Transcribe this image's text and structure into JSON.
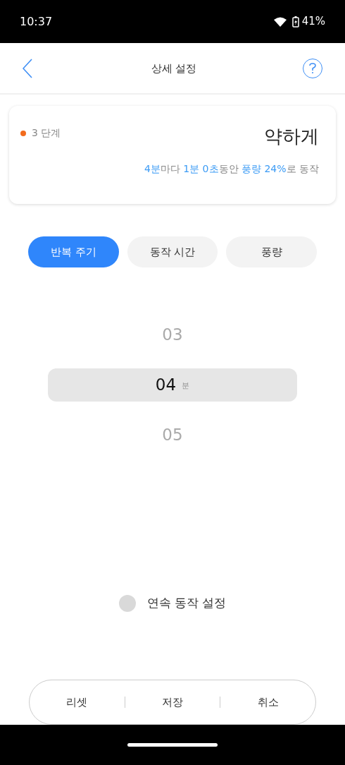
{
  "status_bar": {
    "time": "10:37",
    "battery": "41%"
  },
  "header": {
    "title": "상세 설정"
  },
  "summary": {
    "level": "3 단계",
    "color": "#f26b1d",
    "mode": "약하게",
    "segments": [
      {
        "text": "4분",
        "highlight": true
      },
      {
        "text": "마다 ",
        "highlight": false
      },
      {
        "text": "1분 0초",
        "highlight": true
      },
      {
        "text": "동안 ",
        "highlight": false
      },
      {
        "text": "풍량 24%",
        "highlight": true
      },
      {
        "text": "로 동작",
        "highlight": false
      }
    ]
  },
  "tabs": [
    {
      "label": "반복 주기",
      "selected": true
    },
    {
      "label": "동작 시간",
      "selected": false
    },
    {
      "label": "풍량",
      "selected": false
    }
  ],
  "picker": {
    "unit": "분",
    "items": [
      {
        "value": "03",
        "selected": false
      },
      {
        "value": "04",
        "selected": true
      },
      {
        "value": "05",
        "selected": false
      }
    ]
  },
  "continuous": {
    "label": "연속 동작 설정",
    "checked": false
  },
  "buttons": [
    "리셋",
    "저장",
    "취소"
  ]
}
